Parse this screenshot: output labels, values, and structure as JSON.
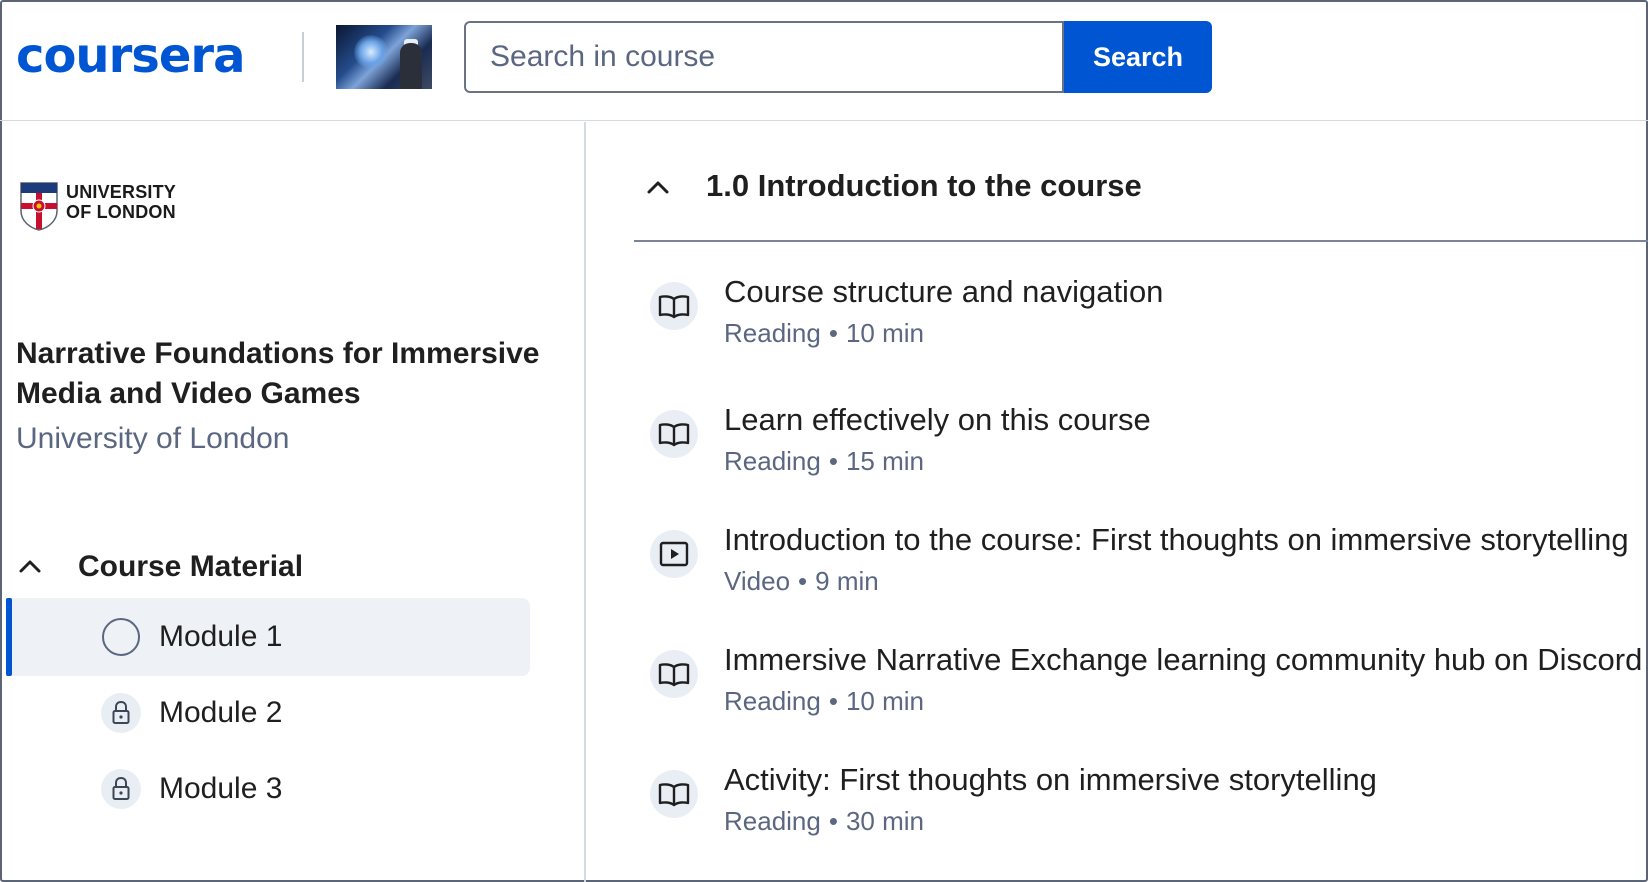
{
  "header": {
    "logo_text": "coursera",
    "search_placeholder": "Search in course",
    "search_button": "Search"
  },
  "sidebar": {
    "university_logo": {
      "line1": "UNIVERSITY",
      "line2": "OF LONDON"
    },
    "course_title": "Narrative Foundations for Immersive Media and Video Games",
    "course_partner": "University of London",
    "section_label": "Course Material",
    "modules": [
      {
        "label": "Module 1",
        "status": "in-progress",
        "active": true
      },
      {
        "label": "Module 2",
        "status": "locked",
        "active": false
      },
      {
        "label": "Module 3",
        "status": "locked",
        "active": false
      }
    ]
  },
  "main": {
    "lesson_title": "1.0 Introduction to the course",
    "items": [
      {
        "title": "Course structure and navigation",
        "type": "Reading",
        "duration": "10 min",
        "icon": "book-icon"
      },
      {
        "title": "Learn effectively on this course",
        "type": "Reading",
        "duration": "15 min",
        "icon": "book-icon"
      },
      {
        "title": "Introduction to the course: First thoughts on immersive storytelling",
        "type": "Video",
        "duration": "9 min",
        "icon": "play-icon"
      },
      {
        "title": "Immersive Narrative Exchange learning community hub on Discord",
        "type": "Reading",
        "duration": "10 min",
        "icon": "book-icon"
      },
      {
        "title": "Activity: First thoughts on immersive storytelling",
        "type": "Reading",
        "duration": "30 min",
        "icon": "book-icon"
      }
    ]
  },
  "colors": {
    "brand": "#0056d2",
    "muted_text": "#5b6780",
    "active_bg": "#eef1f6",
    "icon_bg": "#e9eef5"
  }
}
